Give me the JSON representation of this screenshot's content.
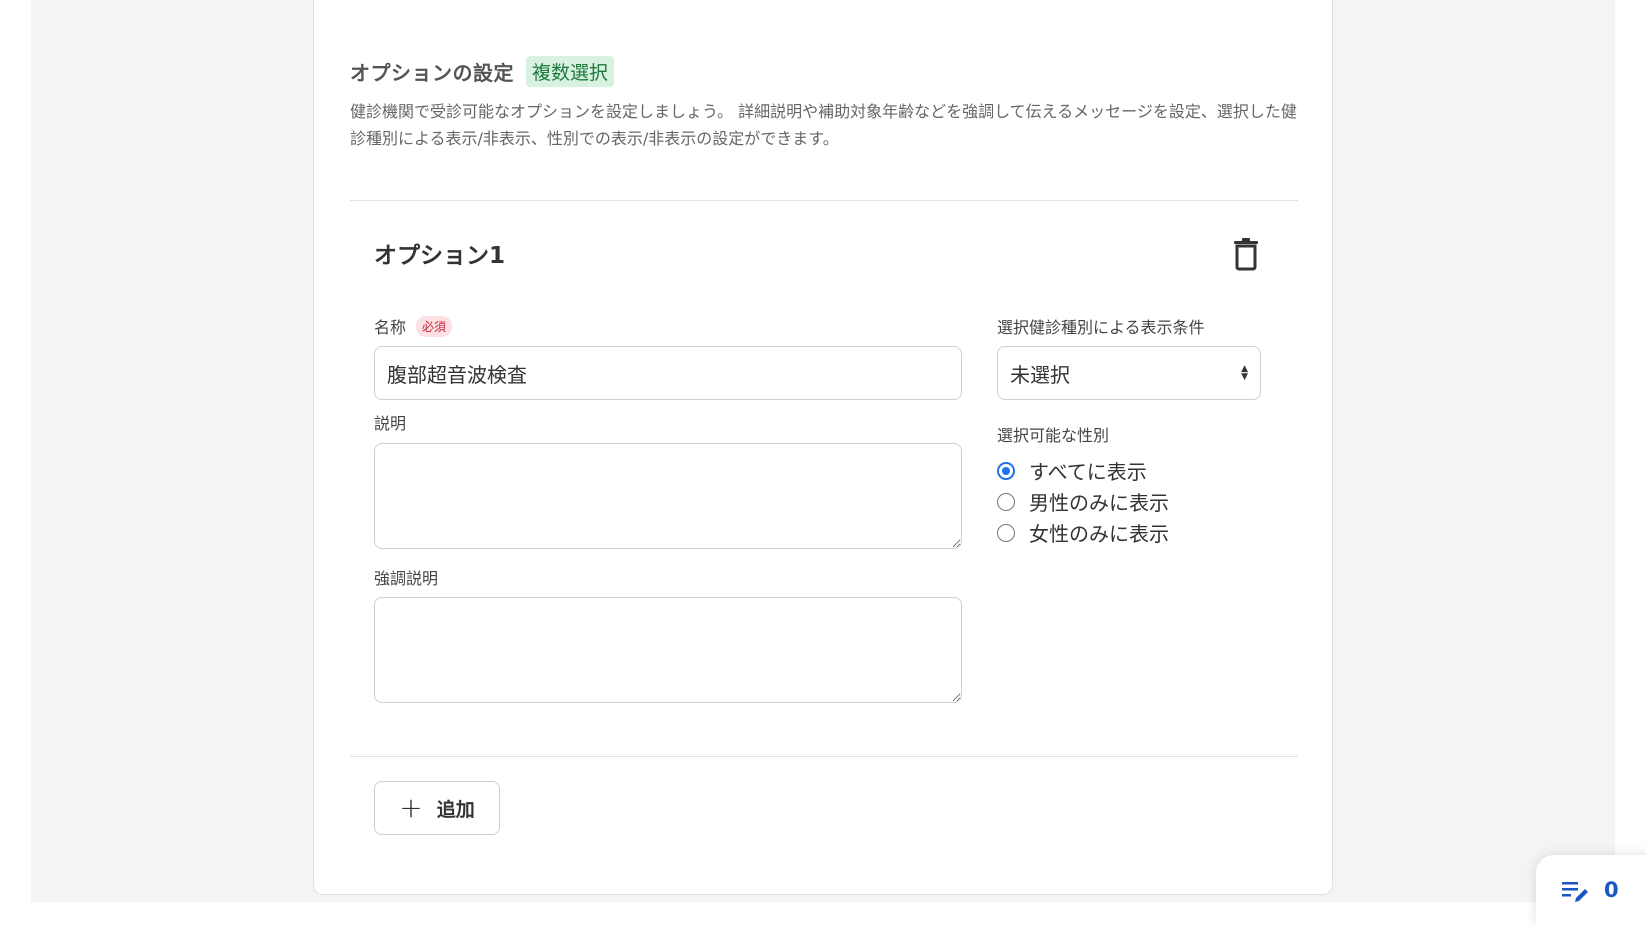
{
  "section": {
    "title": "オプションの設定",
    "badge": "複数選択",
    "description": "健診機関で受診可能なオプションを設定しましょう。 詳細説明や補助対象年齢などを強調して伝えるメッセージを設定、選択した健診種別による表示/非表示、性別での表示/非表示の設定ができます。"
  },
  "option": {
    "title": "オプション1",
    "delete_icon": "trash-icon",
    "name_label": "名称",
    "required_badge": "必須",
    "name_value": "腹部超音波検査",
    "description_label": "説明",
    "description_value": "",
    "emphasis_label": "強調説明",
    "emphasis_value": "",
    "checkup_condition_label": "選択健診種別による表示条件",
    "checkup_condition_value": "未選択",
    "gender_label": "選択可能な性別",
    "gender_options": [
      {
        "label": "すべてに表示",
        "checked": true
      },
      {
        "label": "男性のみに表示",
        "checked": false
      },
      {
        "label": "女性のみに表示",
        "checked": false
      }
    ]
  },
  "add_button": {
    "label": "追加",
    "icon": "plus-icon"
  },
  "fab": {
    "icon": "edit-list-icon",
    "count": "0"
  },
  "colors": {
    "accent": "#1a73e8",
    "badge_green_bg": "#d9f1e1",
    "required_red": "#c8283f",
    "page_bg": "#f5f3f4"
  }
}
